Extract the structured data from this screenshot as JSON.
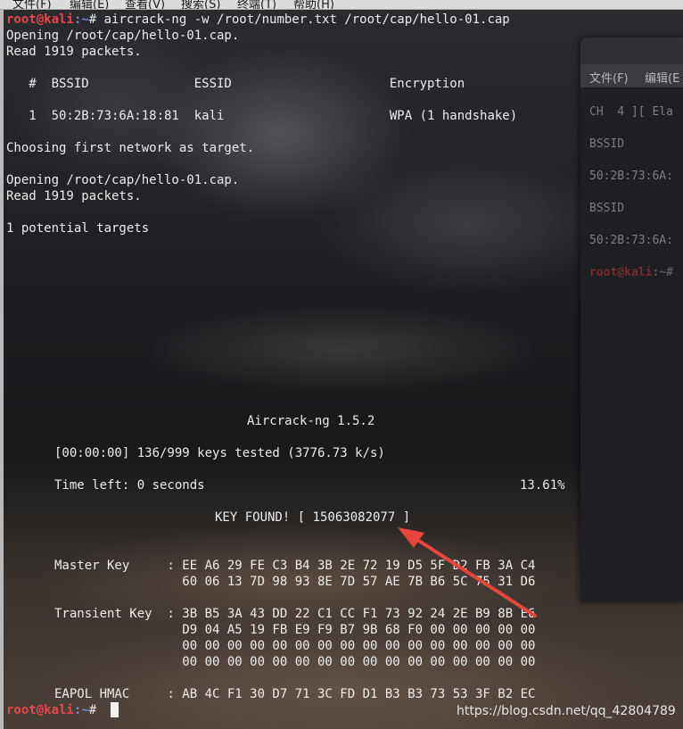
{
  "top_menu": {
    "items": [
      "文件(F)",
      "编辑(E)",
      "查看(V)",
      "搜索(S)",
      "终端(T)",
      "帮助(H)"
    ]
  },
  "background_window": {
    "menu_items": [
      "文件(F)",
      "编辑(E"
    ],
    "lines": [
      "CH  4 ][ Ela",
      "BSSID",
      "50:2B:73:6A:",
      "BSSID",
      "50:2B:73:6A:"
    ],
    "prompt_user": "root@kali",
    "prompt_rest": ":~#"
  },
  "terminal": {
    "prompt_user": "root@kali",
    "prompt_path": ":~",
    "prompt_hash": "# ",
    "command": "aircrack-ng -w /root/number.txt /root/cap/hello-01.cap",
    "opening_1": "Opening /root/cap/hello-01.cap.",
    "read_1": "Read 1919 packets.",
    "table_header": "   #  BSSID              ESSID                     Encryption",
    "table_row": "   1  50:2B:73:6A:18:81  kali                      WPA (1 handshake)",
    "choosing": "Choosing first network as target.",
    "opening_2": "Opening /root/cap/hello-01.cap.",
    "read_2": "Read 1919 packets.",
    "potential": "1 potential targets",
    "title": "Aircrack-ng 1.5.2",
    "keys_tested": "[00:00:00] 136/999 keys tested (3776.73 k/s)",
    "time_left": "Time left: 0 seconds",
    "percent": "13.61%",
    "key_found": "KEY FOUND! [ 15063082077 ]",
    "master_key_1": "Master Key     : EE A6 29 FE C3 B4 3B 2E 72 19 D5 5F D2 FB 3A C4",
    "master_key_2": "                 60 06 13 7D 98 93 8E 7D 57 AE 7B B6 5C 75 31 D6",
    "transient_key_1": "Transient Key  : 3B B5 3A 43 DD 22 C1 CC F1 73 92 24 2E B9 8B E6",
    "transient_key_2": "                 D9 04 A5 19 FB E9 F9 B7 9B 68 F0 00 00 00 00 00",
    "transient_key_3": "                 00 00 00 00 00 00 00 00 00 00 00 00 00 00 00 00",
    "transient_key_4": "                 00 00 00 00 00 00 00 00 00 00 00 00 00 00 00 00",
    "eapol_hmac": "EAPOL HMAC     : AB 4C F1 30 D7 71 3C FD D1 B3 B3 73 53 3F B2 EC"
  },
  "watermark": "https://blog.csdn.net/qq_42804789",
  "colors": {
    "prompt_user": "#e8464a",
    "prompt_path": "#6f8fd8",
    "arrow": "#e8463c"
  }
}
